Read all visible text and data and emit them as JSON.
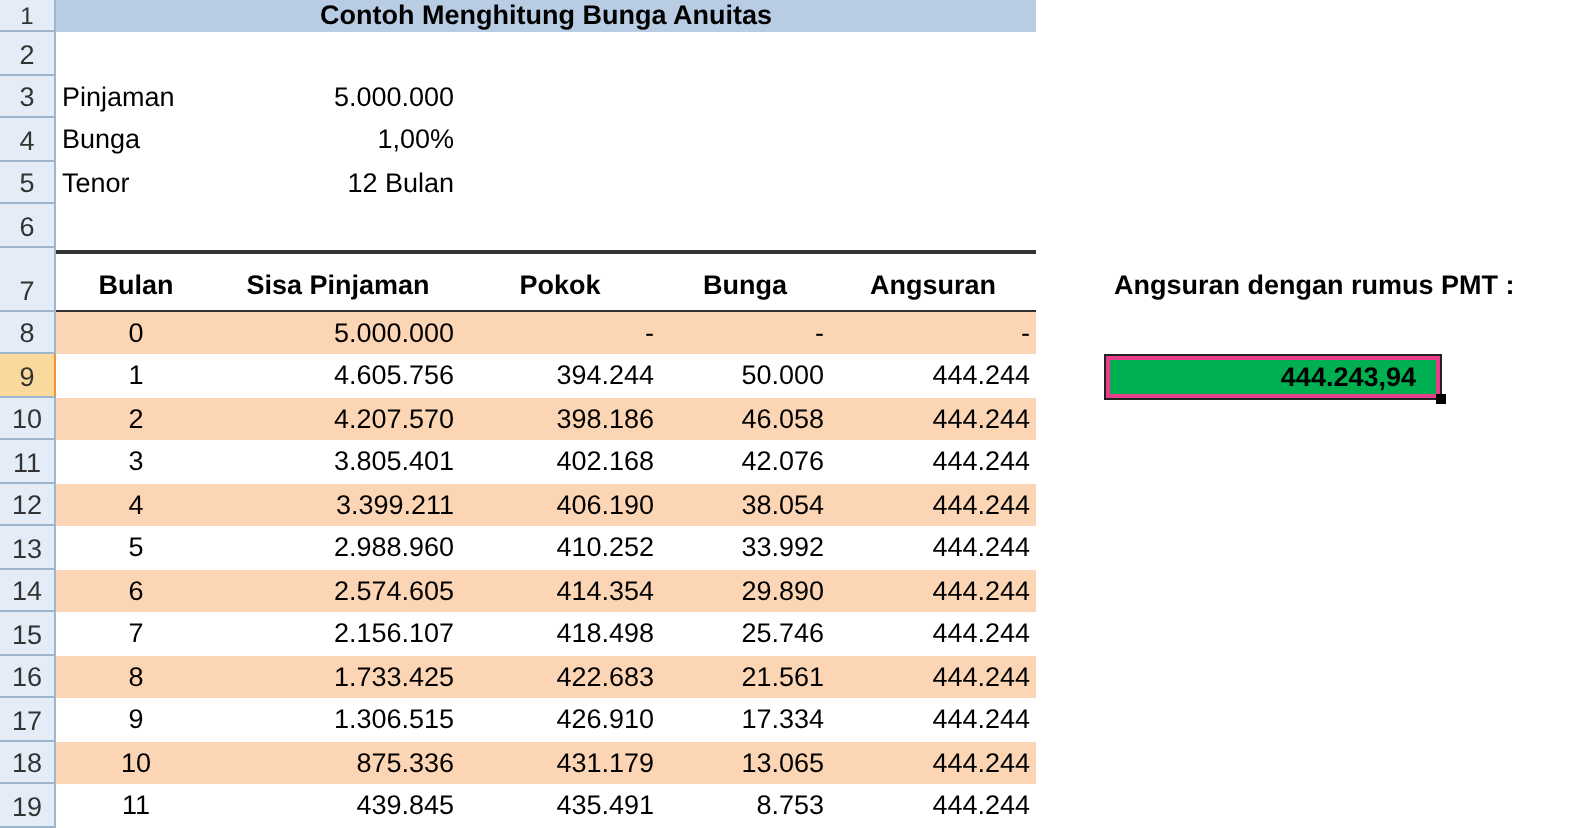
{
  "sheet": {
    "title": "Contoh Menghitung Bunga Anuitas",
    "row_headers": [
      {
        "label": "1",
        "selected": false
      },
      {
        "label": "2",
        "selected": false
      },
      {
        "label": "3",
        "selected": false
      },
      {
        "label": "4",
        "selected": false
      },
      {
        "label": "5",
        "selected": false
      },
      {
        "label": "6",
        "selected": false
      },
      {
        "label": "7",
        "selected": false
      },
      {
        "label": "8",
        "selected": false
      },
      {
        "label": "9",
        "selected": true
      },
      {
        "label": "10",
        "selected": false
      },
      {
        "label": "11",
        "selected": false
      },
      {
        "label": "12",
        "selected": false
      },
      {
        "label": "13",
        "selected": false
      },
      {
        "label": "14",
        "selected": false
      },
      {
        "label": "15",
        "selected": false
      },
      {
        "label": "16",
        "selected": false
      },
      {
        "label": "17",
        "selected": false
      },
      {
        "label": "18",
        "selected": false
      },
      {
        "label": "19",
        "selected": false
      }
    ],
    "parameters": [
      {
        "label": "Pinjaman",
        "value": "5.000.000"
      },
      {
        "label": "Bunga",
        "value": "1,00%"
      },
      {
        "label": "Tenor",
        "value": "12 Bulan"
      }
    ],
    "table": {
      "columns": [
        "Bulan",
        "Sisa Pinjaman",
        "Pokok",
        "Bunga",
        "Angsuran"
      ],
      "rows": [
        [
          "0",
          "5.000.000",
          "-",
          "-",
          "-"
        ],
        [
          "1",
          "4.605.756",
          "394.244",
          "50.000",
          "444.244"
        ],
        [
          "2",
          "4.207.570",
          "398.186",
          "46.058",
          "444.244"
        ],
        [
          "3",
          "3.805.401",
          "402.168",
          "42.076",
          "444.244"
        ],
        [
          "4",
          "3.399.211",
          "406.190",
          "38.054",
          "444.244"
        ],
        [
          "5",
          "2.988.960",
          "410.252",
          "33.992",
          "444.244"
        ],
        [
          "6",
          "2.574.605",
          "414.354",
          "29.890",
          "444.244"
        ],
        [
          "7",
          "2.156.107",
          "418.498",
          "25.746",
          "444.244"
        ],
        [
          "8",
          "1.733.425",
          "422.683",
          "21.561",
          "444.244"
        ],
        [
          "9",
          "1.306.515",
          "426.910",
          "17.334",
          "444.244"
        ],
        [
          "10",
          "875.336",
          "431.179",
          "13.065",
          "444.244"
        ],
        [
          "11",
          "439.845",
          "435.491",
          "8.753",
          "444.244"
        ]
      ]
    },
    "pmt": {
      "label": "Angsuran dengan rumus PMT :",
      "value": "444.243,94",
      "selected": true
    }
  }
}
